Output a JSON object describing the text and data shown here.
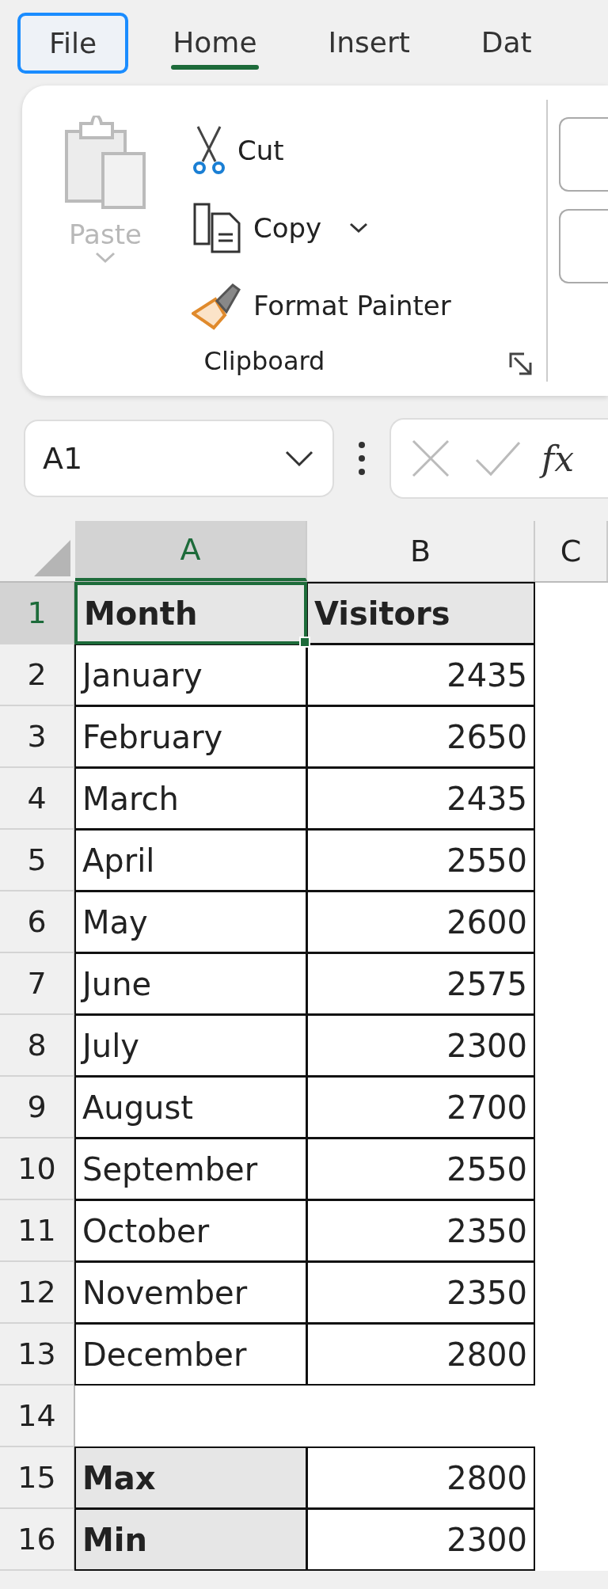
{
  "ribbon_tabs": [
    {
      "label": "File",
      "selected": false,
      "focused": true
    },
    {
      "label": "Home",
      "selected": true,
      "focused": false
    },
    {
      "label": "Insert",
      "selected": false,
      "focused": false
    },
    {
      "label": "Dat",
      "selected": false,
      "focused": false
    }
  ],
  "clipboard": {
    "paste": {
      "label": "Paste",
      "disabled": true
    },
    "commands": [
      {
        "label": "Cut",
        "kind": "cut",
        "dropdown": false
      },
      {
        "label": "Copy",
        "kind": "copy",
        "dropdown": true
      },
      {
        "label": "Format Painter",
        "kind": "painter",
        "dropdown": false
      }
    ],
    "group_label": "Clipboard"
  },
  "name_box": {
    "value": "A1"
  },
  "formula_bar": {
    "fx": "fx"
  },
  "columns": [
    {
      "label": "A",
      "selected": true
    },
    {
      "label": "B",
      "selected": false
    },
    {
      "label": "C",
      "selected": false
    }
  ],
  "rows": [
    {
      "number": "1",
      "selected": true,
      "cells": [
        {
          "text": "Month",
          "kind": "header",
          "selected": true
        },
        {
          "text": "Visitors",
          "kind": "header",
          "selected": false
        }
      ]
    },
    {
      "number": "2",
      "selected": false,
      "cells": [
        {
          "text": "January",
          "kind": "text",
          "selected": false
        },
        {
          "text": "2435",
          "kind": "number",
          "selected": false
        }
      ]
    },
    {
      "number": "3",
      "selected": false,
      "cells": [
        {
          "text": "February",
          "kind": "text",
          "selected": false
        },
        {
          "text": "2650",
          "kind": "number",
          "selected": false
        }
      ]
    },
    {
      "number": "4",
      "selected": false,
      "cells": [
        {
          "text": "March",
          "kind": "text",
          "selected": false
        },
        {
          "text": "2435",
          "kind": "number",
          "selected": false
        }
      ]
    },
    {
      "number": "5",
      "selected": false,
      "cells": [
        {
          "text": "April",
          "kind": "text",
          "selected": false
        },
        {
          "text": "2550",
          "kind": "number",
          "selected": false
        }
      ]
    },
    {
      "number": "6",
      "selected": false,
      "cells": [
        {
          "text": "May",
          "kind": "text",
          "selected": false
        },
        {
          "text": "2600",
          "kind": "number",
          "selected": false
        }
      ]
    },
    {
      "number": "7",
      "selected": false,
      "cells": [
        {
          "text": "June",
          "kind": "text",
          "selected": false
        },
        {
          "text": "2575",
          "kind": "number",
          "selected": false
        }
      ]
    },
    {
      "number": "8",
      "selected": false,
      "cells": [
        {
          "text": "July",
          "kind": "text",
          "selected": false
        },
        {
          "text": "2300",
          "kind": "number",
          "selected": false
        }
      ]
    },
    {
      "number": "9",
      "selected": false,
      "cells": [
        {
          "text": "August",
          "kind": "text",
          "selected": false
        },
        {
          "text": "2700",
          "kind": "number",
          "selected": false
        }
      ]
    },
    {
      "number": "10",
      "selected": false,
      "cells": [
        {
          "text": "September",
          "kind": "text",
          "selected": false
        },
        {
          "text": "2550",
          "kind": "number",
          "selected": false
        }
      ]
    },
    {
      "number": "11",
      "selected": false,
      "cells": [
        {
          "text": "October",
          "kind": "text",
          "selected": false
        },
        {
          "text": "2350",
          "kind": "number",
          "selected": false
        }
      ]
    },
    {
      "number": "12",
      "selected": false,
      "cells": [
        {
          "text": "November",
          "kind": "text",
          "selected": false
        },
        {
          "text": "2350",
          "kind": "number",
          "selected": false
        }
      ]
    },
    {
      "number": "13",
      "selected": false,
      "cells": [
        {
          "text": "December",
          "kind": "text",
          "selected": false
        },
        {
          "text": "2800",
          "kind": "number",
          "selected": false
        }
      ]
    },
    {
      "number": "14",
      "selected": false,
      "cells": []
    },
    {
      "number": "15",
      "selected": false,
      "cells": [
        {
          "text": "Max",
          "kind": "label",
          "selected": false
        },
        {
          "text": "2800",
          "kind": "number",
          "selected": false
        }
      ]
    },
    {
      "number": "16",
      "selected": false,
      "cells": [
        {
          "text": "Min",
          "kind": "label",
          "selected": false
        },
        {
          "text": "2300",
          "kind": "number",
          "selected": false
        }
      ]
    }
  ]
}
